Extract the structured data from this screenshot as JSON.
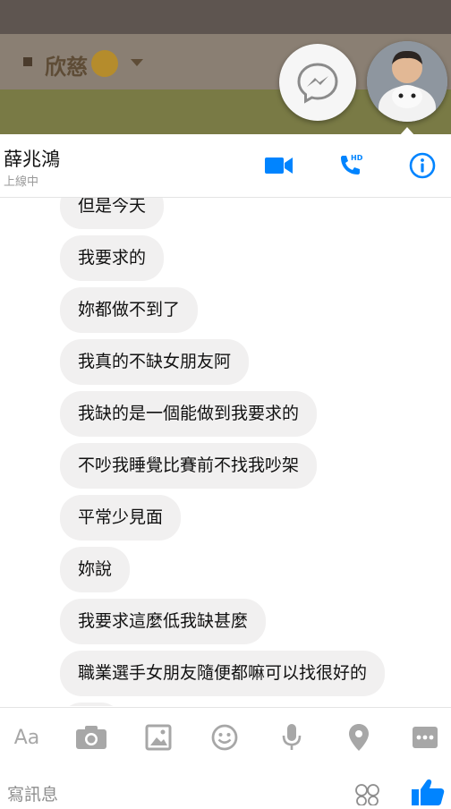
{
  "background_app": {
    "title": "欣慈"
  },
  "chat": {
    "contact_name": "薛兆鴻",
    "contact_status": "上線中",
    "header_icons": [
      "video-call-icon",
      "hd-voice-call-icon",
      "info-icon"
    ],
    "messages": [
      "但是今天",
      "我要求的",
      "妳都做不到了",
      "我真的不缺女朋友阿",
      "我缺的是一個能做到我要求的",
      "不吵我睡覺比賽前不找我吵架",
      "平常少見面",
      "妳說",
      "我要求這麼低我缺甚麼",
      "職業選手女朋友隨便都嘛可以找很好的"
    ]
  },
  "toolbar": {
    "aa_label": "Aa",
    "icons": [
      "camera-icon",
      "image-icon",
      "smiley-icon",
      "microphone-icon",
      "location-icon",
      "more-icon"
    ]
  },
  "composer": {
    "placeholder": "寫訊息",
    "icons": [
      "emoji-sticker-icon",
      "thumbs-up-icon"
    ]
  },
  "colors": {
    "accent": "#0084ff",
    "bubble": "#f1f0f0",
    "icon_gray": "#a7a7a7"
  }
}
